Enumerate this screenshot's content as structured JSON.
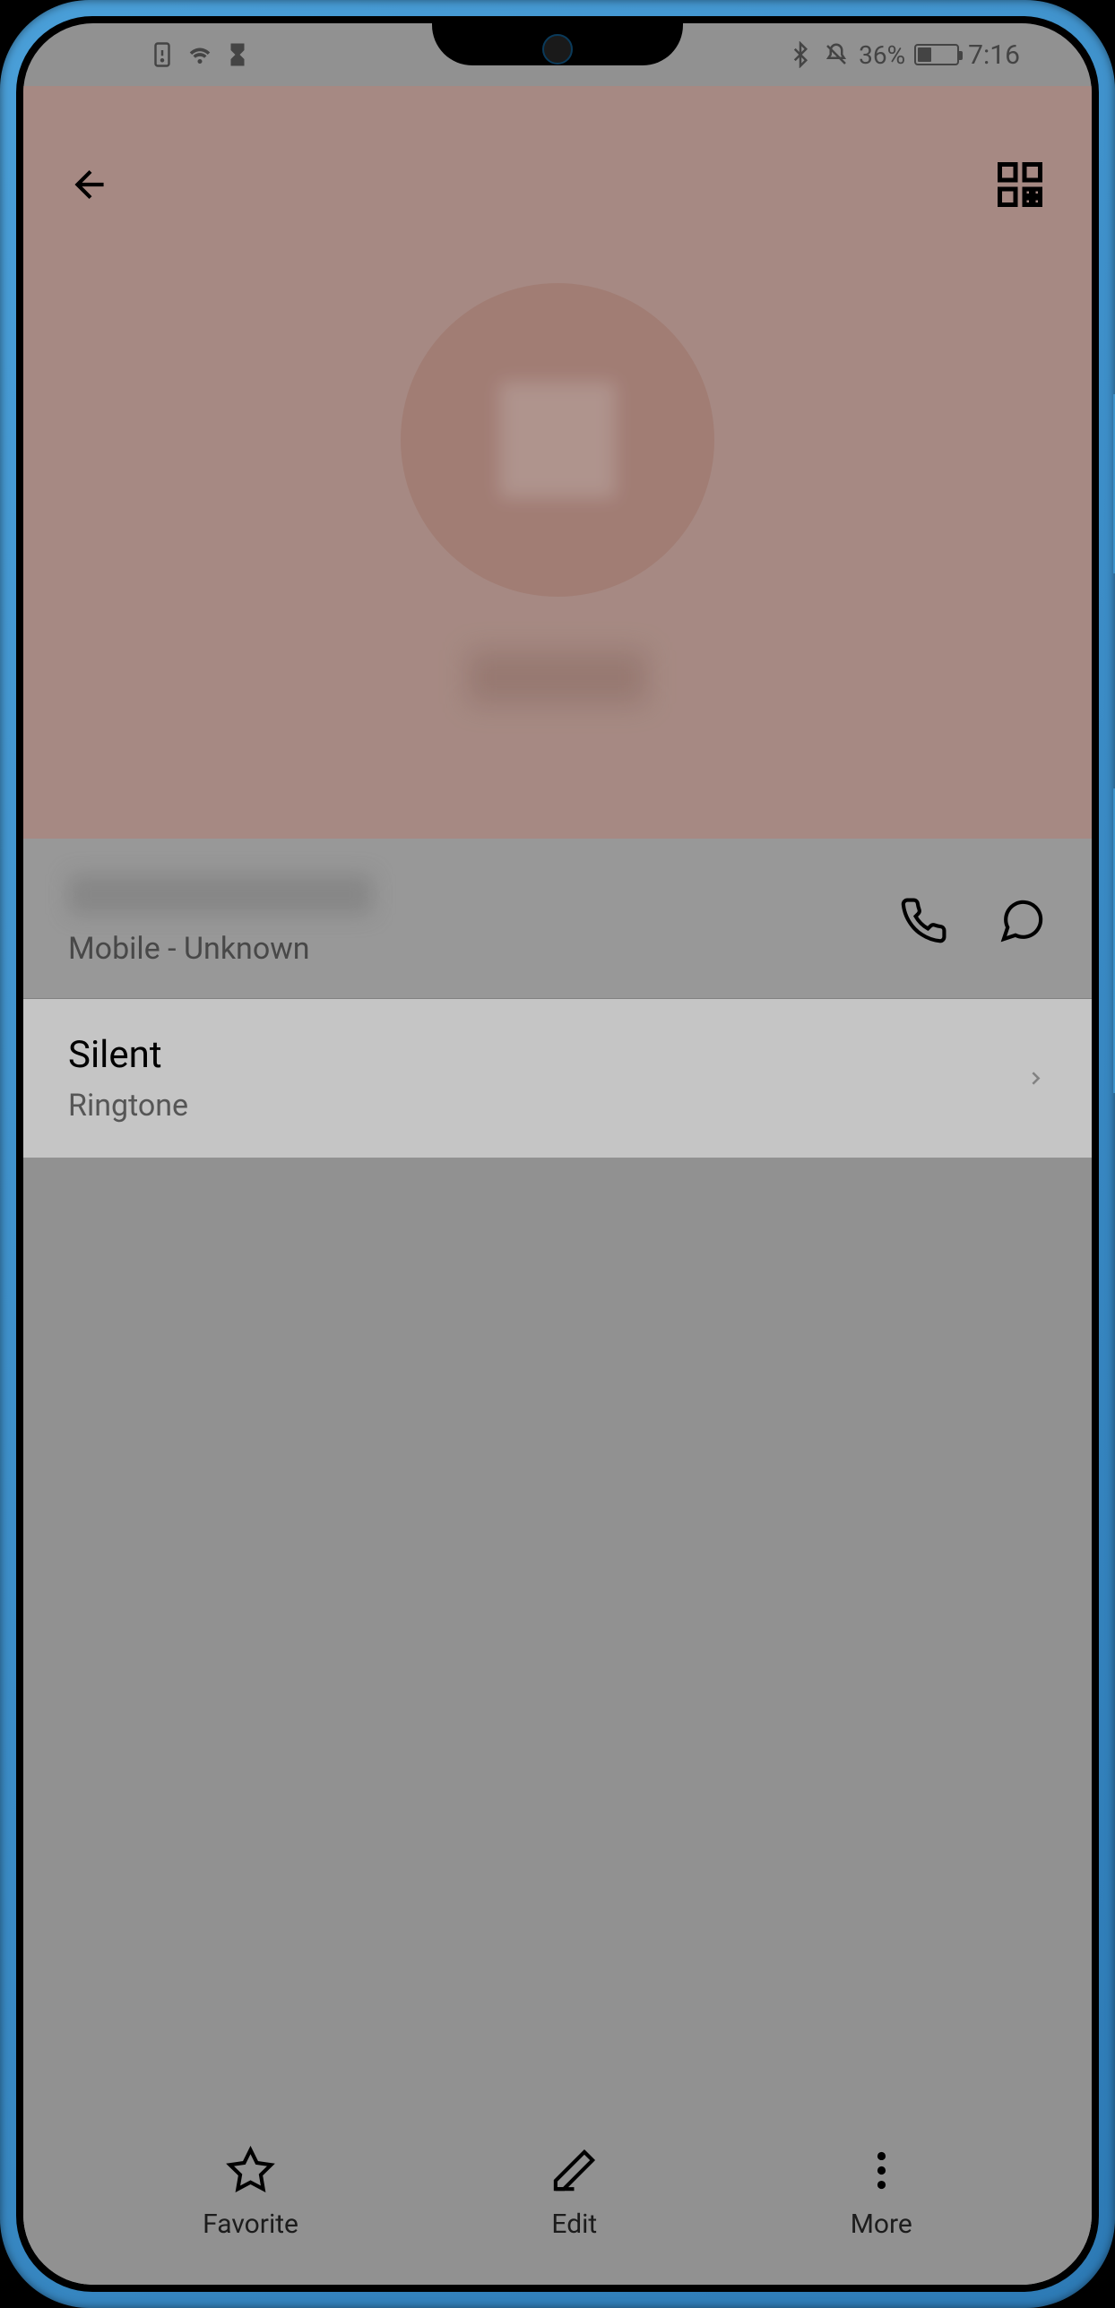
{
  "statusBar": {
    "battery": "36%",
    "time": "7:16"
  },
  "contact": {
    "phoneLabel": "Mobile - Unknown"
  },
  "ringtone": {
    "title": "Silent",
    "subtitle": "Ringtone"
  },
  "bottomBar": {
    "favorite": "Favorite",
    "edit": "Edit",
    "more": "More"
  }
}
